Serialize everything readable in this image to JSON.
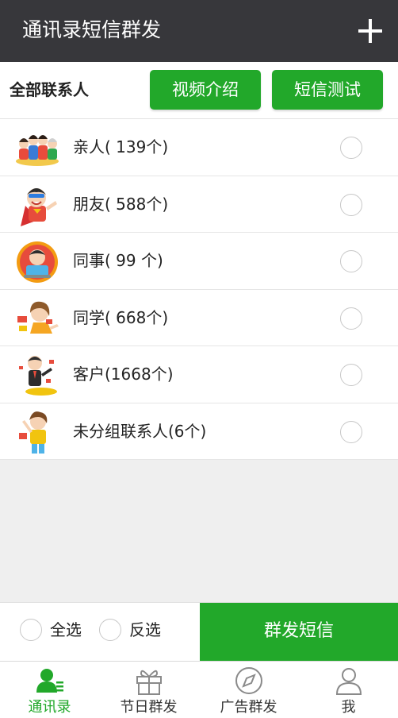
{
  "header": {
    "title": "通讯录短信群发",
    "add_icon": "plus-icon"
  },
  "toolbar": {
    "all_contacts_label": "全部联系人",
    "video_button": "视频介绍",
    "sms_test_button": "短信测试"
  },
  "colors": {
    "accent": "#22a82a",
    "header_bg": "#37373b",
    "page_bg": "#efefef"
  },
  "groups": [
    {
      "label": "亲人( 139个)",
      "icon": "family-avatar-icon"
    },
    {
      "label": "朋友( 588个)",
      "icon": "superhero-avatar-icon"
    },
    {
      "label": "同事(  99 个)",
      "icon": "colleague-avatar-icon"
    },
    {
      "label": "同学( 668个)",
      "icon": "classmate-avatar-icon"
    },
    {
      "label": "客户(1668个)",
      "icon": "customer-avatar-icon"
    },
    {
      "label": "未分组联系人(6个)",
      "icon": "ungrouped-avatar-icon"
    }
  ],
  "bottom": {
    "select_all": "全选",
    "invert_select": "反选",
    "send_button": "群发短信"
  },
  "tabs": [
    {
      "label": "通讯录",
      "icon": "contacts-icon",
      "active": true
    },
    {
      "label": "节日群发",
      "icon": "gift-icon",
      "active": false
    },
    {
      "label": "广告群发",
      "icon": "compass-icon",
      "active": false
    },
    {
      "label": "我",
      "icon": "user-icon",
      "active": false
    }
  ]
}
